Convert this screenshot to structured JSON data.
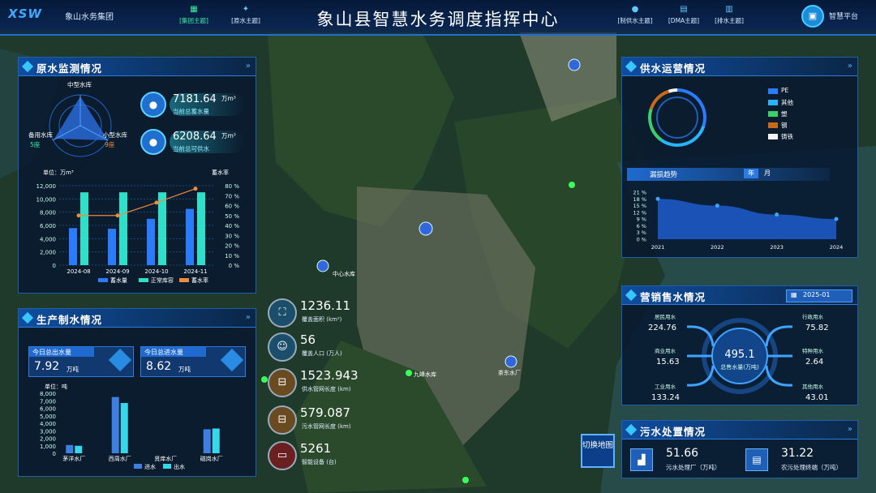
{
  "header": {
    "logo": "XSW",
    "group": "象山水务集团",
    "title": "象山县智慧水务调度指挥中心",
    "nav_left": [
      "[集团主题]",
      "[原水主题]"
    ],
    "nav_right": [
      "[制供水主题]",
      "[DMA主题]",
      "[排水主题]"
    ],
    "platform": "智慧平台",
    "platform_icon": "monitor-icon"
  },
  "raw_water": {
    "title": "原水监测情况",
    "radar_labels": {
      "top": "中型水库",
      "left": "备用水库",
      "right": "小型水库"
    },
    "radar_counts": {
      "left": "5座",
      "right": "9座"
    },
    "stats": [
      {
        "value": "7181.64",
        "unit": "万m³",
        "label": "当前总蓄水量"
      },
      {
        "value": "6208.64",
        "unit": "万m³",
        "label": "当前总可供水"
      }
    ],
    "chart_data": {
      "type": "bar",
      "categories": [
        "2024-08",
        "2024-09",
        "2024-10",
        "2024-11"
      ],
      "series": [
        {
          "name": "蓄水量",
          "values": [
            5600,
            5500,
            7000,
            8500
          ]
        },
        {
          "name": "正常库容",
          "values": [
            11000,
            11000,
            11000,
            11000
          ]
        },
        {
          "name": "蓄水率",
          "values": [
            50,
            50,
            63,
            77
          ]
        }
      ],
      "ylabel": "单位：万m³",
      "y2label": "蓄水率",
      "ylim": [
        0,
        12000
      ],
      "y2lim": [
        0,
        80
      ],
      "yticks": [
        "12,000",
        "10,000",
        "8,000",
        "6,000",
        "4,000",
        "2,000",
        "0"
      ],
      "y2ticks": [
        "80 %",
        "70 %",
        "60 %",
        "50 %",
        "40 %",
        "30 %",
        "20 %",
        "10 %",
        "0 %"
      ],
      "colors": [
        "#2a7cff",
        "#2fe0c8",
        "#f08a3c"
      ]
    }
  },
  "production": {
    "title": "生产制水情况",
    "cards": [
      {
        "label": "今日总出水量",
        "value": "7.92",
        "unit": "万吨"
      },
      {
        "label": "今日总进水量",
        "value": "8.62",
        "unit": "万吨"
      }
    ],
    "chart_data": {
      "type": "bar",
      "categories": [
        "茅洋水厂",
        "西周水厂",
        "贤庠水厂",
        "磁岗水厂"
      ],
      "series": [
        {
          "name": "进水",
          "values": [
            1100,
            7500,
            0,
            3200
          ]
        },
        {
          "name": "出水",
          "values": [
            1000,
            6700,
            0,
            3300
          ]
        }
      ],
      "ylabel": "单位：吨",
      "ylim": [
        0,
        8000
      ],
      "yticks": [
        "8,000",
        "7,000",
        "6,000",
        "5,000",
        "4,000",
        "3,000",
        "2,000",
        "1,000",
        "0"
      ],
      "colors": [
        "#3f7fe0",
        "#34d8e8"
      ]
    }
  },
  "center_stats": [
    {
      "value": "1236.11",
      "label": "覆盖面积 (km²)",
      "icon": "map-icon"
    },
    {
      "value": "56",
      "label": "覆盖人口 (万人)",
      "icon": "people-icon"
    },
    {
      "value": "1523.943",
      "label": "供水管网长度 (km)",
      "icon": "pipe-icon"
    },
    {
      "value": "579.087",
      "label": "污水管网长度 (km)",
      "icon": "pipe-icon"
    },
    {
      "value": "5261",
      "label": "智能设备 (台)",
      "icon": "device-icon"
    }
  ],
  "switch_map": "切换地图",
  "supply": {
    "title": "供水运营情况",
    "legend": [
      {
        "name": "PE",
        "color": "#2a7cff"
      },
      {
        "name": "其他",
        "color": "#28b4ff"
      },
      {
        "name": "塑",
        "color": "#3ad06a"
      },
      {
        "name": "钢",
        "color": "#c86a18"
      },
      {
        "name": "铸铁",
        "color": "#f4f4f4"
      }
    ],
    "ring_fractions": [
      0.3,
      0.3,
      0.2,
      0.15,
      0.05
    ],
    "trend_title": "漏损趋势",
    "toggle": [
      "年",
      "月"
    ],
    "chart_data": {
      "type": "area",
      "x": [
        "2021",
        "2022",
        "2023",
        "2024"
      ],
      "values": [
        18,
        15,
        11,
        9
      ],
      "ylim": [
        0,
        21
      ],
      "yticks": [
        "21 %",
        "18 %",
        "15 %",
        "12 %",
        "9 %",
        "6 %",
        "3 %",
        "0 %"
      ]
    }
  },
  "sales": {
    "title": "营销售水情况",
    "date": "2025-01",
    "center_value": "495.1",
    "center_label": "总售水量(万吨)",
    "items": [
      {
        "label": "居民用水",
        "value": "224.76"
      },
      {
        "label": "商业用水",
        "value": "15.63"
      },
      {
        "label": "工业用水",
        "value": "133.24"
      },
      {
        "label": "行政用水",
        "value": "75.82"
      },
      {
        "label": "特种用水",
        "value": "2.64"
      },
      {
        "label": "其他用水",
        "value": "43.01"
      }
    ]
  },
  "sewage": {
    "title": "污水处置情况",
    "items": [
      {
        "value": "51.66",
        "label": "污水处理厂（万吨）"
      },
      {
        "value": "31.22",
        "label": "农污处理终端（万吨）"
      }
    ]
  },
  "map_labels": [
    "中心水库",
    "九峰水库",
    "茶东水厂"
  ]
}
